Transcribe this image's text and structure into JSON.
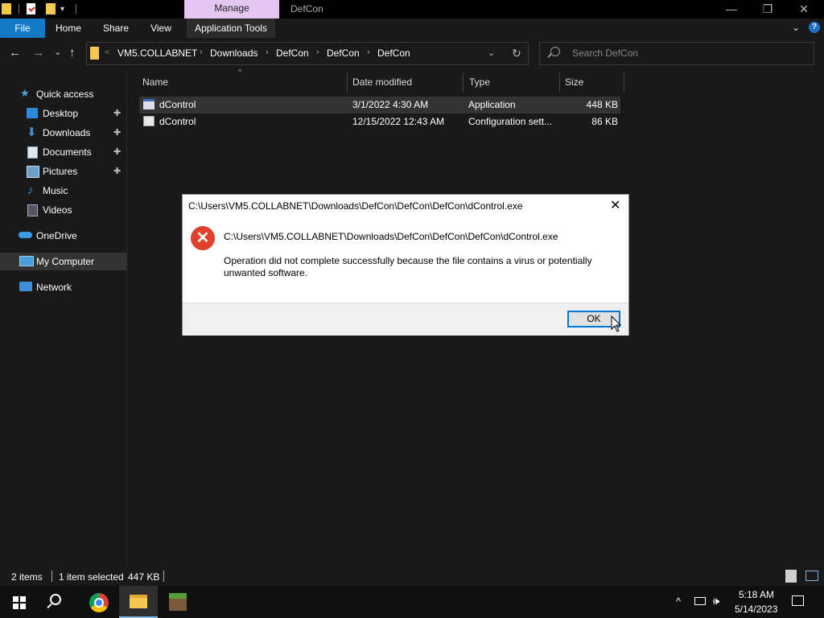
{
  "window": {
    "context_tab": "Manage",
    "title": "DefCon"
  },
  "ribbon": {
    "tabs": [
      "File",
      "Home",
      "Share",
      "View",
      "Application Tools"
    ],
    "accent": "#1479c4"
  },
  "address": {
    "prefix": "«",
    "crumbs": [
      "VM5.COLLABNET",
      "Downloads",
      "DefCon",
      "DefCon",
      "DefCon"
    ],
    "separator": "›"
  },
  "search": {
    "placeholder": "Search DefCon"
  },
  "nav": {
    "items": [
      {
        "label": "Quick access",
        "icon": "star-icon"
      },
      {
        "label": "Desktop",
        "icon": "desktop-icon",
        "pinned": true
      },
      {
        "label": "Downloads",
        "icon": "download-icon",
        "pinned": true
      },
      {
        "label": "Documents",
        "icon": "documents-icon",
        "pinned": true
      },
      {
        "label": "Pictures",
        "icon": "pictures-icon",
        "pinned": true
      },
      {
        "label": "Music",
        "icon": "music-icon"
      },
      {
        "label": "Videos",
        "icon": "videos-icon"
      },
      {
        "label": "OneDrive",
        "icon": "cloud-icon"
      },
      {
        "label": "My Computer",
        "icon": "computer-icon",
        "selected": true
      },
      {
        "label": "Network",
        "icon": "network-icon"
      }
    ]
  },
  "files": {
    "columns": [
      "Name",
      "Date modified",
      "Type",
      "Size"
    ],
    "rows": [
      {
        "name": "dControl",
        "date": "3/1/2022 4:30 AM",
        "type": "Application",
        "size": "448 KB",
        "selected": true
      },
      {
        "name": "dControl",
        "date": "12/15/2022 12:43 AM",
        "type": "Configuration sett...",
        "size": "86 KB"
      }
    ]
  },
  "status": {
    "count": "2 items",
    "selected": "1 item selected",
    "size": "447 KB"
  },
  "dialog": {
    "title": "C:\\Users\\VM5.COLLABNET\\Downloads\\DefCon\\DefCon\\DefCon\\dControl.exe",
    "path": "C:\\Users\\VM5.COLLABNET\\Downloads\\DefCon\\DefCon\\DefCon\\dControl.exe",
    "message": "Operation did not complete successfully because the file contains a virus or potentially unwanted software.",
    "ok_label": "OK",
    "close_glyph": "✕",
    "error_glyph": "✕"
  },
  "taskbar": {
    "time": "5:18 AM",
    "date": "5/14/2023",
    "apps": [
      "start-icon",
      "search-icon",
      "chrome-icon",
      "file-explorer-icon",
      "minecraft-icon"
    ]
  },
  "glyphs": {
    "minimize": "—",
    "restore": "❐",
    "close": "✕",
    "back": "←",
    "forward": "→",
    "recent": "⌄",
    "up": "↑",
    "refresh": "↻",
    "dropdown": "⌄",
    "chevron": "⌄",
    "help": "?",
    "pin": "✚",
    "sort_up": "^",
    "tray_up": "^",
    "volume": "🕪",
    "network": "▭"
  }
}
